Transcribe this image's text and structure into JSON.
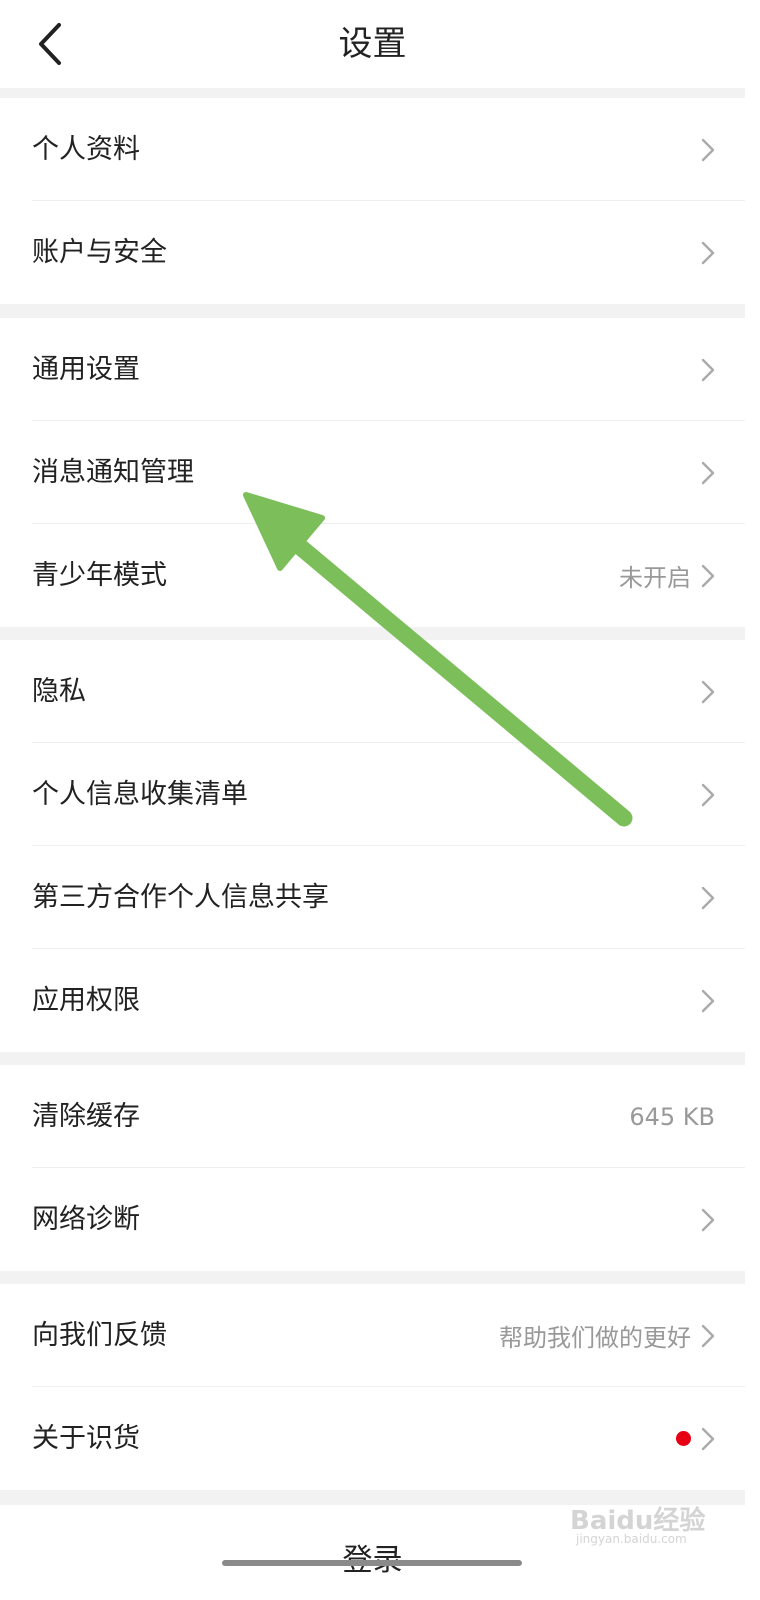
{
  "header": {
    "title": "设置"
  },
  "groups": [
    {
      "items": [
        {
          "label": "个人资料"
        },
        {
          "label": "账户与安全"
        }
      ]
    },
    {
      "items": [
        {
          "label": "通用设置"
        },
        {
          "label": "消息通知管理"
        },
        {
          "label": "青少年模式",
          "value": "未开启"
        }
      ]
    },
    {
      "items": [
        {
          "label": "隐私"
        },
        {
          "label": "个人信息收集清单"
        },
        {
          "label": "第三方合作个人信息共享"
        },
        {
          "label": "应用权限"
        }
      ]
    },
    {
      "items": [
        {
          "label": "清除缓存",
          "value": "645 KB"
        },
        {
          "label": "网络诊断"
        }
      ]
    },
    {
      "items": [
        {
          "label": "向我们反馈",
          "value": "帮助我们做的更好"
        },
        {
          "label": "关于识货"
        }
      ]
    }
  ],
  "login": {
    "label": "登录"
  },
  "watermark": {
    "text": "Baidu经验",
    "sub": "jingyan.baidu.com"
  },
  "colors": {
    "background": "#f2f2f2",
    "card": "#ffffff",
    "text": "#222222",
    "secondary_text": "#999999",
    "badge_dot": "#e60012",
    "annotation_arrow": "#7cbf5a"
  },
  "icons": {
    "back": "back-chevron-icon",
    "row_right": "chevron-right-icon",
    "notice_dot": "red-dot-badge"
  }
}
